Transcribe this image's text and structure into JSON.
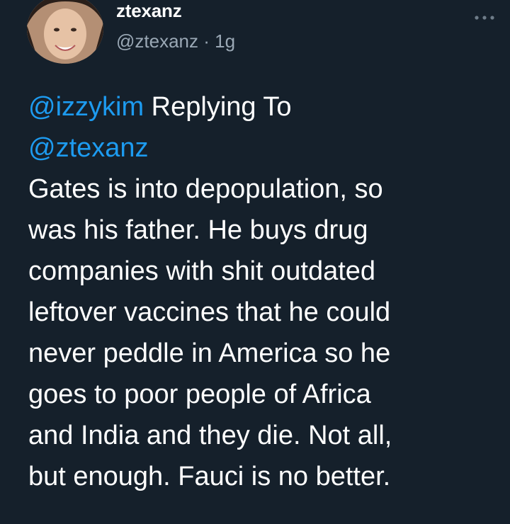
{
  "author": {
    "display_name": "ztexanz",
    "handle": "@ztexanz",
    "separator": " · ",
    "time": "1g"
  },
  "more_menu_icon": "more-dots-icon",
  "tweet": {
    "reply_mention": "@izzykim",
    "replying_to_label": " Replying To",
    "mention_target": "@ztexanz",
    "lines": [
      "Gates is into depopulation, so",
      "was his father. He buys drug",
      "companies with shit outdated",
      "leftover vaccines that he could",
      "never peddle in America so he",
      "goes to poor people of Africa",
      "and India and they die. Not all,",
      "but enough. Fauci is no better."
    ]
  },
  "colors": {
    "background": "#15202b",
    "mention": "#1d9bf0",
    "secondary_text": "#9aa8b5"
  }
}
